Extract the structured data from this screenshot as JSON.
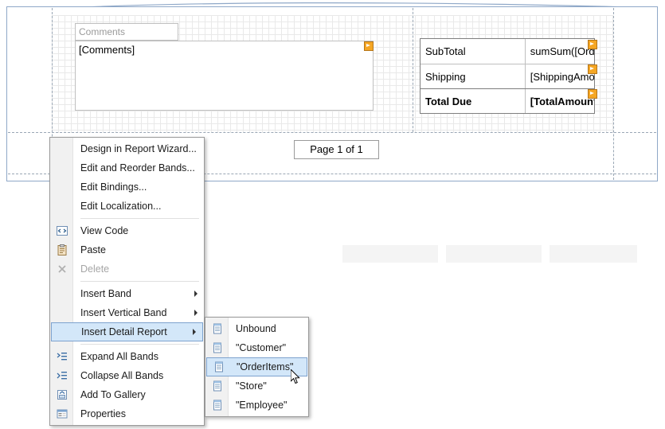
{
  "report": {
    "comments_label_placeholder": "Comments",
    "comments_field": "[Comments]",
    "totals": [
      {
        "label": "SubTotal",
        "value": "sumSum([Ord"
      },
      {
        "label": "Shipping",
        "value": "[ShippingAmo"
      },
      {
        "label": "Total Due",
        "value": "[TotalAmount"
      }
    ],
    "page_footer": "Page 1 of 1"
  },
  "context_menu": {
    "items": [
      {
        "label": "Design in Report Wizard...",
        "icon": "none",
        "state": "normal",
        "submenu": false
      },
      {
        "label": "Edit and Reorder Bands...",
        "icon": "none",
        "state": "normal",
        "submenu": false
      },
      {
        "label": "Edit Bindings...",
        "icon": "none",
        "state": "normal",
        "submenu": false
      },
      {
        "label": "Edit Localization...",
        "icon": "none",
        "state": "normal",
        "submenu": false
      },
      {
        "label": "View Code",
        "icon": "code-icon",
        "state": "normal",
        "submenu": false
      },
      {
        "label": "Paste",
        "icon": "clipboard-icon",
        "state": "normal",
        "submenu": false
      },
      {
        "label": "Delete",
        "icon": "delete-x-icon",
        "state": "disabled",
        "submenu": false
      },
      {
        "label": "Insert Band",
        "icon": "none",
        "state": "normal",
        "submenu": true
      },
      {
        "label": "Insert Vertical Band",
        "icon": "none",
        "state": "normal",
        "submenu": true
      },
      {
        "label": "Insert Detail Report",
        "icon": "none",
        "state": "highlight",
        "submenu": true
      },
      {
        "label": "Expand All Bands",
        "icon": "expand-bands-icon",
        "state": "normal",
        "submenu": false
      },
      {
        "label": "Collapse All Bands",
        "icon": "collapse-bands-icon",
        "state": "normal",
        "submenu": false
      },
      {
        "label": "Add To Gallery",
        "icon": "gallery-icon",
        "state": "normal",
        "submenu": false
      },
      {
        "label": "Properties",
        "icon": "properties-icon",
        "state": "normal",
        "submenu": false
      }
    ]
  },
  "detail_report_submenu": {
    "items": [
      {
        "label": "Unbound",
        "state": "normal"
      },
      {
        "label": "\"Customer\"",
        "state": "normal"
      },
      {
        "label": "\"OrderItems\"",
        "state": "highlight"
      },
      {
        "label": "\"Store\"",
        "state": "normal"
      },
      {
        "label": "\"Employee\"",
        "state": "normal"
      }
    ]
  },
  "colors": {
    "highlight_fill": "#d3e7f9",
    "highlight_border": "#7da2ce",
    "smart_tag": "#f5a623",
    "page_border": "#8fa8c8"
  }
}
